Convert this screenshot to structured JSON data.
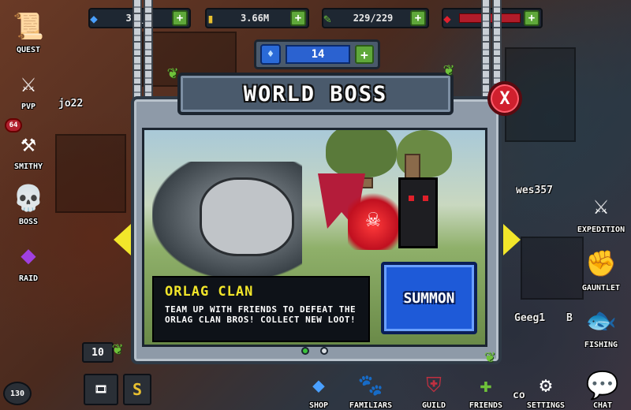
{
  "topbar": {
    "gems": "3,_2",
    "gold": "3.66M",
    "energy": "229/229",
    "health_bar": ""
  },
  "left_menu": [
    {
      "key": "quest",
      "label": "QUEST",
      "icon": "scroll-icon"
    },
    {
      "key": "pvp",
      "label": "PVP",
      "icon": "crossed-swords-icon"
    },
    {
      "key": "smithy",
      "label": "SMITHY",
      "icon": "anvil-icon"
    },
    {
      "key": "boss",
      "label": "BOSS",
      "icon": "skull-icon"
    },
    {
      "key": "raid",
      "label": "RAID",
      "icon": "crystal-icon"
    }
  ],
  "smithy_badge": "64",
  "right_menu": [
    {
      "key": "expedition",
      "label": "EXPEDITION",
      "icon": "swords-icon"
    },
    {
      "key": "gauntlet",
      "label": "GAUNTLET",
      "icon": "gauntlet-icon"
    },
    {
      "key": "fishing",
      "label": "FISHING",
      "icon": "fish-icon"
    }
  ],
  "bottom_menu": [
    {
      "key": "shop",
      "label": "SHOP",
      "icon": "gem-icon"
    },
    {
      "key": "familiars",
      "label": "FAMILIARS",
      "icon": "paw-icon"
    },
    {
      "key": "guild",
      "label": "GUILD",
      "icon": "shield-icon"
    },
    {
      "key": "friends",
      "label": "FRIENDS",
      "icon": "plus-icon"
    },
    {
      "key": "settings",
      "label": "SETTINGS",
      "icon": "gear-icon"
    },
    {
      "key": "chat",
      "label": "CHAT",
      "icon": "chat-bubble-icon"
    }
  ],
  "bg_players": {
    "p1": "jo22",
    "p2": "wes357",
    "p3": "Geeg1",
    "p4": "B",
    "p5": "co"
  },
  "level_box": "10",
  "player_level": "130",
  "modal": {
    "counter": "14",
    "title": "WORLD BOSS",
    "close": "X",
    "boss_name": "ORLAG CLAN",
    "description": "TEAM UP WITH FRIENDS TO DEFEAT THE ORLAG CLAN BROS! COLLECT NEW LOOT!",
    "summon": "SUMMON",
    "page": 1,
    "pages": 2
  },
  "colors": {
    "summon": "#1e5ad8",
    "boss_name": "#f2e62a",
    "close": "#d0202e",
    "plus": "#5fa83a"
  }
}
